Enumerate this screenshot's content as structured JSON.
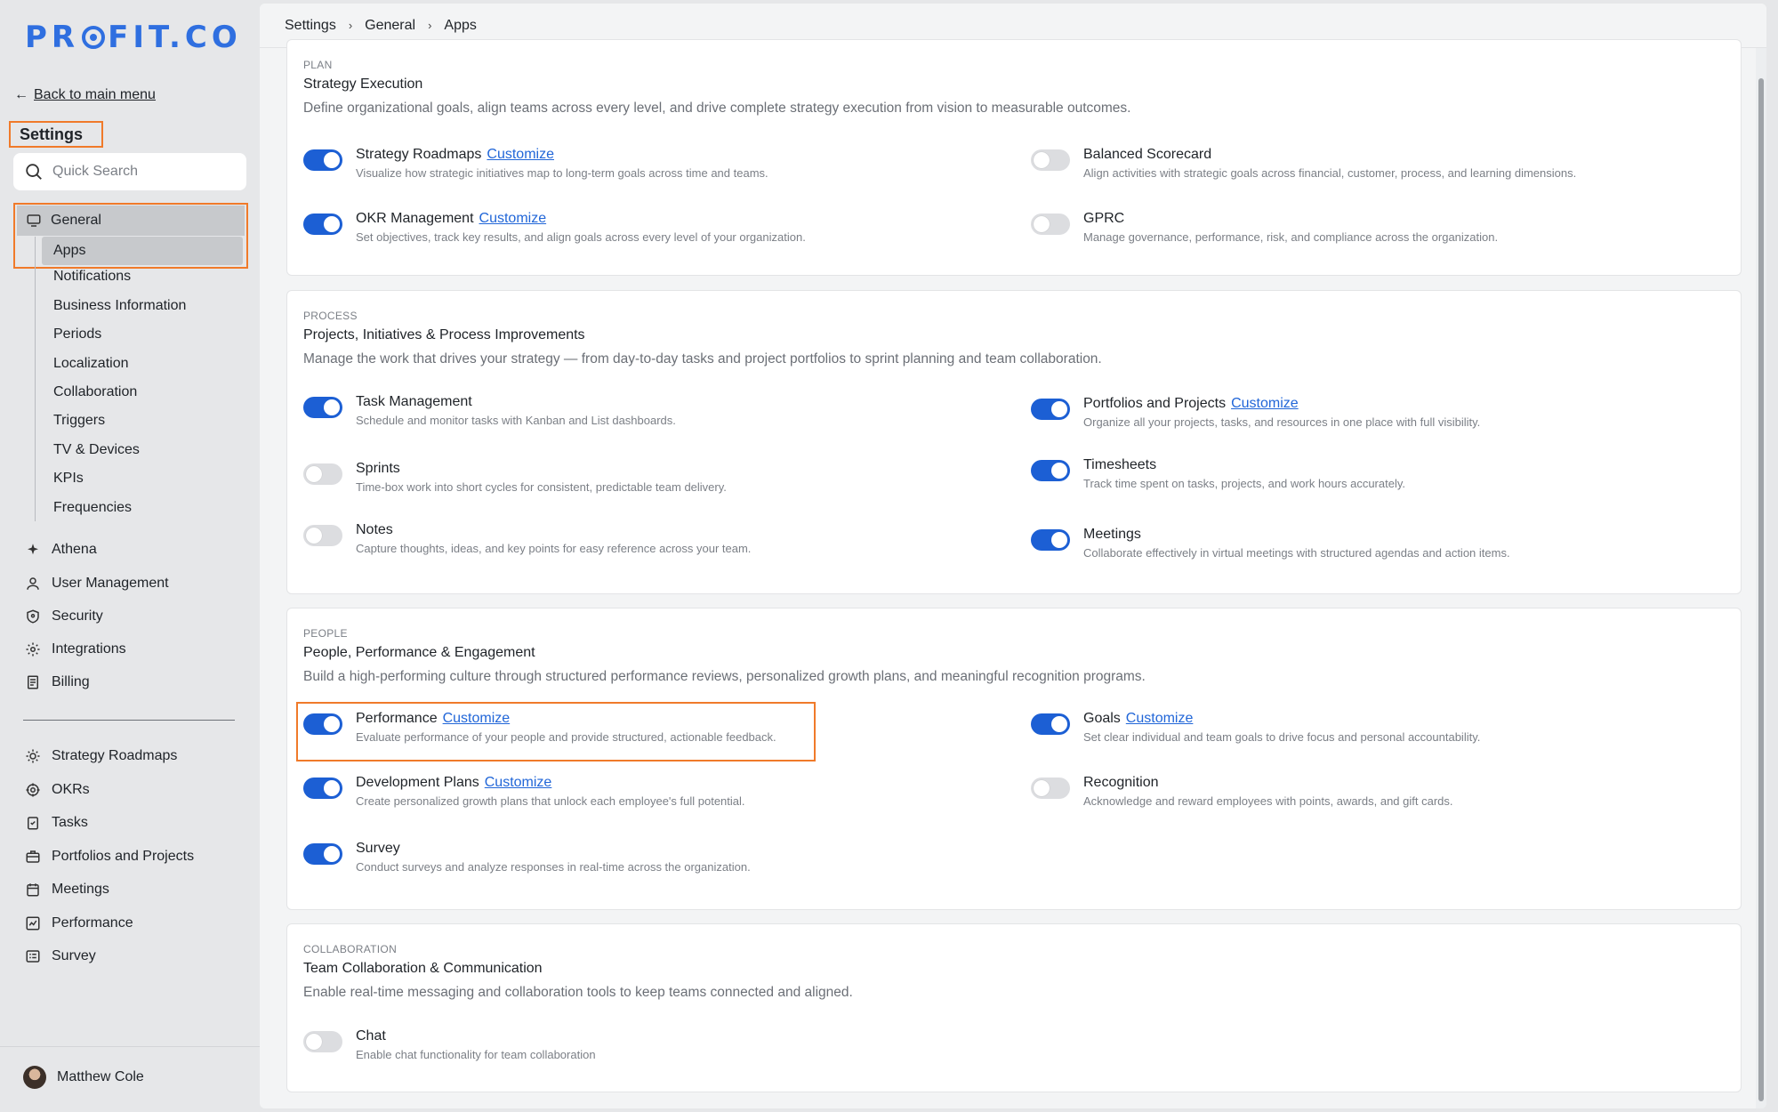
{
  "logo": {
    "text": "PROFIT.CO",
    "pre": "PR",
    "post": "FIT.CO"
  },
  "sidebar": {
    "back_label": "Back to main menu",
    "title": "Settings",
    "search_placeholder": "Quick Search",
    "general_label": "General",
    "general_items": [
      "Apps",
      "Notifications",
      "Business Information",
      "Periods",
      "Localization",
      "Collaboration",
      "Triggers",
      "TV & Devices",
      "KPIs",
      "Frequencies"
    ],
    "settings_items": [
      {
        "label": "Athena",
        "icon": "sparkle-icon"
      },
      {
        "label": "User Management",
        "icon": "user-icon"
      },
      {
        "label": "Security",
        "icon": "shield-icon"
      },
      {
        "label": "Integrations",
        "icon": "gear-icon"
      },
      {
        "label": "Billing",
        "icon": "receipt-icon"
      }
    ],
    "module_items": [
      {
        "label": "Strategy Roadmaps",
        "icon": "sun-icon"
      },
      {
        "label": "OKRs",
        "icon": "target-icon"
      },
      {
        "label": "Tasks",
        "icon": "clipboard-check-icon"
      },
      {
        "label": "Portfolios and Projects",
        "icon": "briefcase-icon"
      },
      {
        "label": "Meetings",
        "icon": "calendar-icon"
      },
      {
        "label": "Performance",
        "icon": "chart-icon"
      },
      {
        "label": "Survey",
        "icon": "list-icon"
      }
    ],
    "user_name": "Matthew Cole"
  },
  "breadcrumb": [
    "Settings",
    "General",
    "Apps"
  ],
  "customize_label": "Customize",
  "sections": [
    {
      "category": "PLAN",
      "title": "Strategy Execution",
      "description": "Define organizational goals, align teams across every level, and drive complete strategy execution from vision to measurable outcomes.",
      "apps": [
        {
          "name": "Strategy Roadmaps",
          "description": "Visualize how strategic initiatives map to long-term goals across time and teams.",
          "enabled": true,
          "customize": true
        },
        {
          "name": "Balanced Scorecard",
          "description": "Align activities with strategic goals across financial, customer, process, and learning dimensions.",
          "enabled": false,
          "customize": false
        },
        {
          "name": "OKR Management",
          "description": "Set objectives, track key results, and align goals across every level of your organization.",
          "enabled": true,
          "customize": true
        },
        {
          "name": "GPRC",
          "description": "Manage governance, performance, risk, and compliance across the organization.",
          "enabled": false,
          "customize": false
        }
      ]
    },
    {
      "category": "PROCESS",
      "title": "Projects, Initiatives & Process Improvements",
      "description": "Manage the work that drives your strategy — from day-to-day tasks and project portfolios to sprint planning and team collaboration.",
      "apps": [
        {
          "name": "Task Management",
          "description": "Schedule and monitor tasks with Kanban and List dashboards.",
          "enabled": true,
          "customize": false
        },
        {
          "name": "Portfolios and Projects",
          "description": "Organize all your projects, tasks, and resources in one place with full visibility.",
          "enabled": true,
          "customize": true
        },
        {
          "name": "Sprints",
          "description": "Time-box work into short cycles for consistent, predictable team delivery.",
          "enabled": false,
          "customize": false
        },
        {
          "name": "Timesheets",
          "description": "Track time spent on tasks, projects, and work hours accurately.",
          "enabled": true,
          "customize": false
        },
        {
          "name": "Notes",
          "description": "Capture thoughts, ideas, and key points for easy reference across your team.",
          "enabled": false,
          "customize": false
        },
        {
          "name": "Meetings",
          "description": "Collaborate effectively in virtual meetings with structured agendas and action items.",
          "enabled": true,
          "customize": false
        }
      ]
    },
    {
      "category": "PEOPLE",
      "title": "People, Performance & Engagement",
      "description": "Build a high-performing culture through structured performance reviews, personalized growth plans, and meaningful recognition programs.",
      "apps": [
        {
          "name": "Performance",
          "description": "Evaluate performance of your people and provide structured, actionable feedback.",
          "enabled": true,
          "customize": true
        },
        {
          "name": "Goals",
          "description": "Set clear individual and team goals to drive focus and personal accountability.",
          "enabled": true,
          "customize": true
        },
        {
          "name": "Development Plans",
          "description": "Create personalized growth plans that unlock each employee's full potential.",
          "enabled": true,
          "customize": true
        },
        {
          "name": "Recognition",
          "description": "Acknowledge and reward employees with points, awards, and gift cards.",
          "enabled": false,
          "customize": false
        },
        {
          "name": "Survey",
          "description": "Conduct surveys and analyze responses in real-time across the organization.",
          "enabled": true,
          "customize": false
        }
      ]
    },
    {
      "category": "COLLABORATION",
      "title": "Team Collaboration & Communication",
      "description": "Enable real-time messaging and collaboration tools to keep teams connected and aligned.",
      "apps": [
        {
          "name": "Chat",
          "description": "Enable chat functionality for team collaboration",
          "enabled": false,
          "customize": false
        }
      ]
    }
  ],
  "colors": {
    "accent": "#1c5fd4",
    "link": "#2166d8",
    "highlight": "#f07a2a",
    "logo": "#2f6fe0"
  }
}
